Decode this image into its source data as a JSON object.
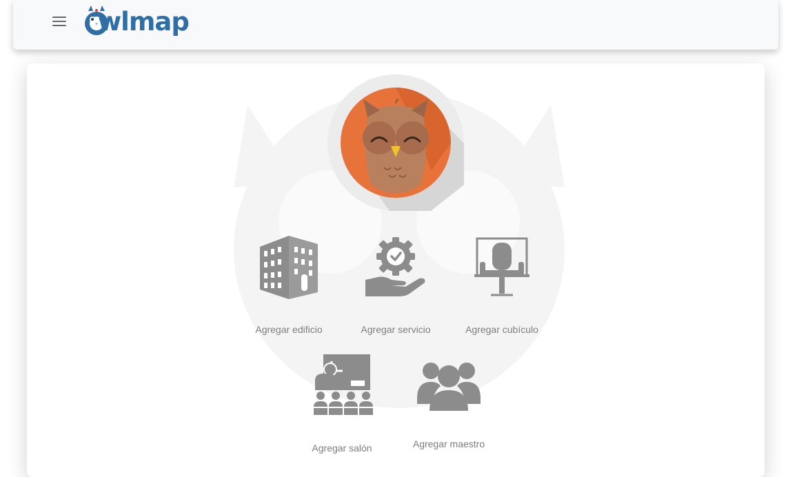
{
  "header": {
    "logo_text": "wlmap",
    "menu_icon": "hamburger-menu-icon",
    "logo_icon": "owl-logo-icon"
  },
  "profile": {
    "avatar_icon": "owl-avatar-icon"
  },
  "actions": [
    {
      "label": "Agregar edificio",
      "icon": "building-icon"
    },
    {
      "label": "Agregar servicio",
      "icon": "hand-gear-service-icon"
    },
    {
      "label": "Agregar cubículo",
      "icon": "cubicle-chair-icon"
    },
    {
      "label": "Agregar salón",
      "icon": "classroom-icon"
    },
    {
      "label": "Agregar maestro",
      "icon": "users-group-icon"
    }
  ],
  "colors": {
    "brand": "#2f6fa6",
    "icon_gray": "#8c8c8c",
    "label_gray": "#7d7d7d",
    "avatar_orange": "#e8733a",
    "navbar_bg": "#f8f9fa"
  }
}
